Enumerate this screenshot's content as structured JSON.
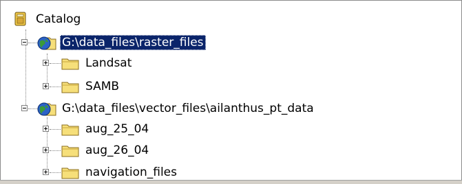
{
  "tree": {
    "root": {
      "label": "Catalog",
      "icon": "catalog-icon"
    },
    "connections": [
      {
        "label": "G:\\data_files\\raster_files",
        "icon": "globe-folder-icon",
        "expanded": true,
        "selected": true,
        "children": [
          {
            "label": "Landsat",
            "icon": "folder-icon",
            "expanded": false
          },
          {
            "label": "SAMB",
            "icon": "folder-icon",
            "expanded": false
          }
        ]
      },
      {
        "label": "G:\\data_files\\vector_files\\ailanthus_pt_data",
        "icon": "globe-folder-icon",
        "expanded": true,
        "selected": false,
        "children": [
          {
            "label": "aug_25_04",
            "icon": "folder-icon",
            "expanded": false
          },
          {
            "label": "aug_26_04",
            "icon": "folder-icon",
            "expanded": false
          },
          {
            "label": "navigation_files",
            "icon": "folder-icon",
            "expanded": false
          }
        ]
      }
    ]
  },
  "colors": {
    "selection": "#0a246a",
    "folder_fill": "#f6df7a",
    "folder_edge": "#8a6d1f",
    "globe_blue": "#2b62c7",
    "globe_green": "#3a9a3a"
  }
}
